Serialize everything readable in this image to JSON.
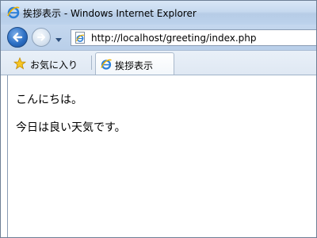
{
  "window": {
    "title": "挨拶表示 - Windows Internet Explorer"
  },
  "navigation": {
    "back_icon": "back-arrow-icon",
    "forward_icon": "forward-arrow-icon",
    "address": "http://localhost/greeting/index.php"
  },
  "favorites": {
    "label": "お気に入り"
  },
  "tabs": [
    {
      "label": "挨拶表示"
    }
  ],
  "content": {
    "paragraphs": [
      "こんにちは。",
      "今日は良い天気です。"
    ]
  },
  "colors": {
    "accent": "#2c6fc4",
    "chrome": "#c6d9ef"
  }
}
